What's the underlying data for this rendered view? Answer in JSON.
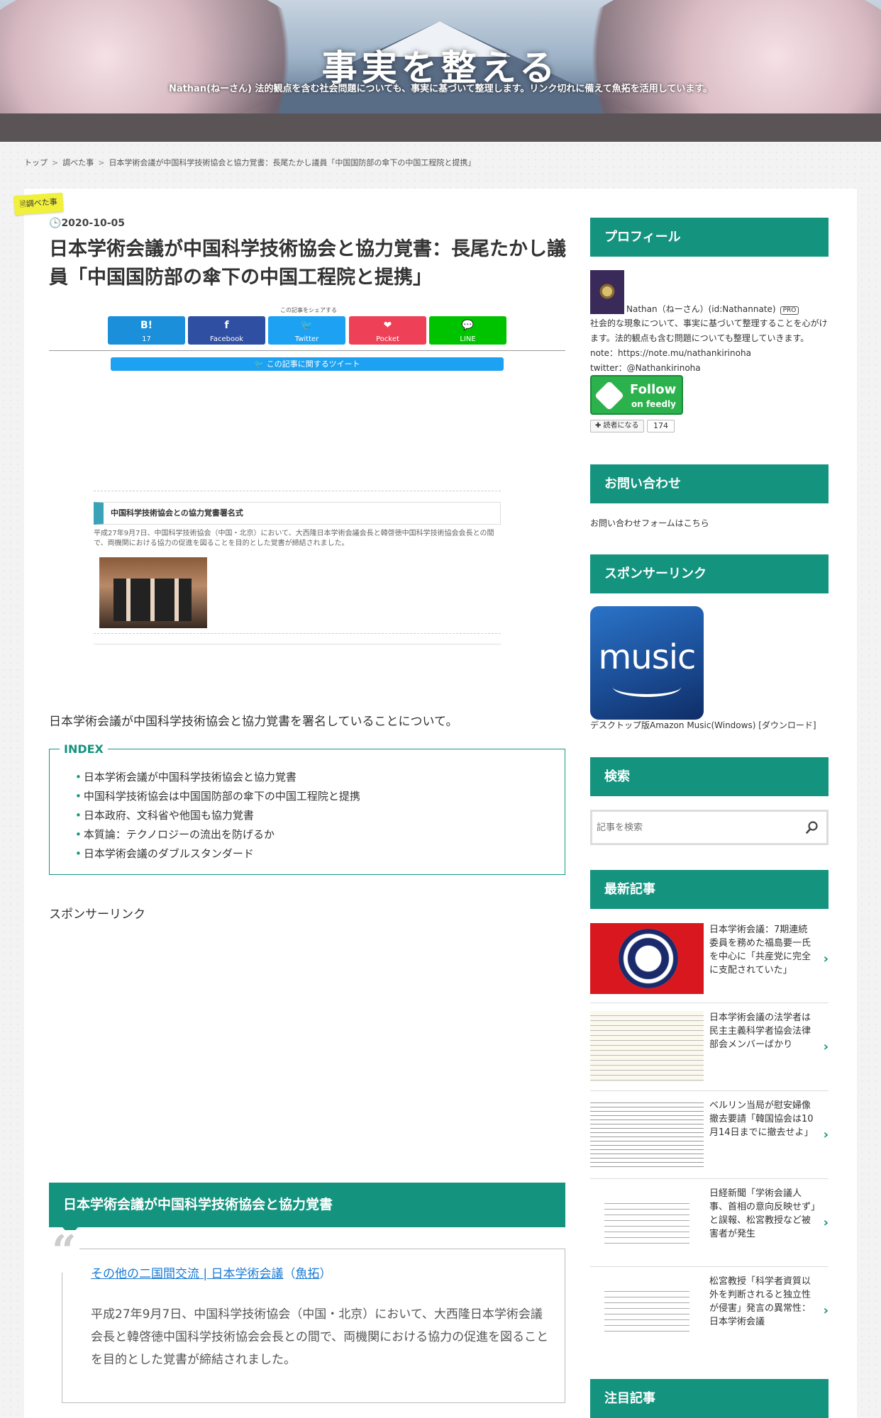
{
  "site": {
    "title": "事実を整える",
    "description": "Nathan(ねーさん) 法的観点を含む社会問題についても、事実に基づいて整理します。リンク切れに備えて魚拓を活用しています。"
  },
  "breadcrumb": [
    "トップ",
    "調べた事",
    "日本学術会議が中国科学技術協会と協力覚書：長尾たかし議員「中国国防部の傘下の中国工程院と提携」"
  ],
  "article": {
    "category": "調べた事",
    "date": "2020-10-05",
    "title": "日本学術会議が中国科学技術協会と協力覚書：長尾たかし議員「中国国防部の傘下の中国工程院と提携」",
    "share_label": "この記事をシェアする",
    "share_buttons": [
      {
        "icon": "B!",
        "label": "17",
        "color": "#1b8fd9"
      },
      {
        "icon": "f",
        "label": "Facebook",
        "color": "#2f4fa3"
      },
      {
        "icon": "🐦",
        "label": "Twitter",
        "color": "#1da1f2"
      },
      {
        "icon": "❤",
        "label": "Pocket",
        "color": "#ee4056"
      },
      {
        "icon": "💬",
        "label": "LINE",
        "color": "#00c300"
      }
    ],
    "tweet_bar": "🐦 この記事に関するツイート",
    "embed": {
      "heading": "中国科学技術協会との協力覚書署名式",
      "text": "平成27年9月7日、中国科学技術協会（中国・北京）において、大西隆日本学術会議会長と韓啓徳中国科学技術協会会長との間で、両機関における協力の促進を図ることを目的とした覚書が締結されました。"
    },
    "intro": "日本学術会議が中国科学技術協会と協力覚書を署名していることについて。",
    "toc": {
      "title": "INDEX",
      "items": [
        "日本学術会議が中国科学技術協会と協力覚書",
        "中国科学技術協会は中国国防部の傘下の中国工程院と提携",
        "日本政府、文科省や他国も協力覚書",
        "本質論：テクノロジーの流出を防げるか",
        "日本学術会議のダブルスタンダード"
      ]
    },
    "sponsor": "スポンサーリンク",
    "h2": "日本学術会議が中国科学技術協会と協力覚書",
    "quote": {
      "link": "その他の二国間交流 | 日本学術会議",
      "gyotaku_open": "（",
      "gyotaku": "魚拓",
      "gyotaku_close": "）",
      "text": "平成27年9月7日、中国科学技術協会（中国・北京）において、大西隆日本学術会議会長と韓啓徳中国科学技術協会会長との間で、両機関における協力の促進を図ることを目的とした覚書が締結されました。"
    }
  },
  "sidebar": {
    "profile": {
      "title": "プロフィール",
      "name": "Nathan（ねーさん）(id:Nathannate)",
      "badge": "PRO",
      "bio": "社会的な現象について、事実に基づいて整理することを心がけます。法的観点も含む問題についても整理していきます。",
      "note": "note：https://note.mu/nathankirinoha",
      "twitter": "twitter：@Nathankirinoha",
      "feedly_follow": "Follow",
      "feedly_on": "on feedly",
      "reader_label": "✚ 読者になる",
      "reader_count": "174"
    },
    "contact": {
      "title": "お問い合わせ",
      "link": "お問い合わせフォームはこちら"
    },
    "sponsor": {
      "title": "スポンサーリンク",
      "music_word": "music",
      "caption": "デスクトップ版Amazon Music(Windows) [ダウンロード]"
    },
    "search": {
      "title": "検索",
      "placeholder": "記事を検索"
    },
    "recent": {
      "title": "最新記事",
      "items": [
        "日本学術会議：7期連続委員を務めた福島要一氏を中心に「共産党に完全に支配されていた」",
        "日本学術会議の法学者は民主主義科学者協会法律部会メンバーばかり",
        "ベルリン当局が慰安婦像撤去要請「韓国協会は10月14日までに撤去せよ」",
        "日経新聞「学術会議人事、首相の意向反映せず」と誤報、松宮教授など被害者が発生",
        "松宮教授「科学者資質以外を判断されると独立性が侵害」発言の異常性：日本学術会議"
      ]
    },
    "featured": {
      "title": "注目記事"
    }
  }
}
